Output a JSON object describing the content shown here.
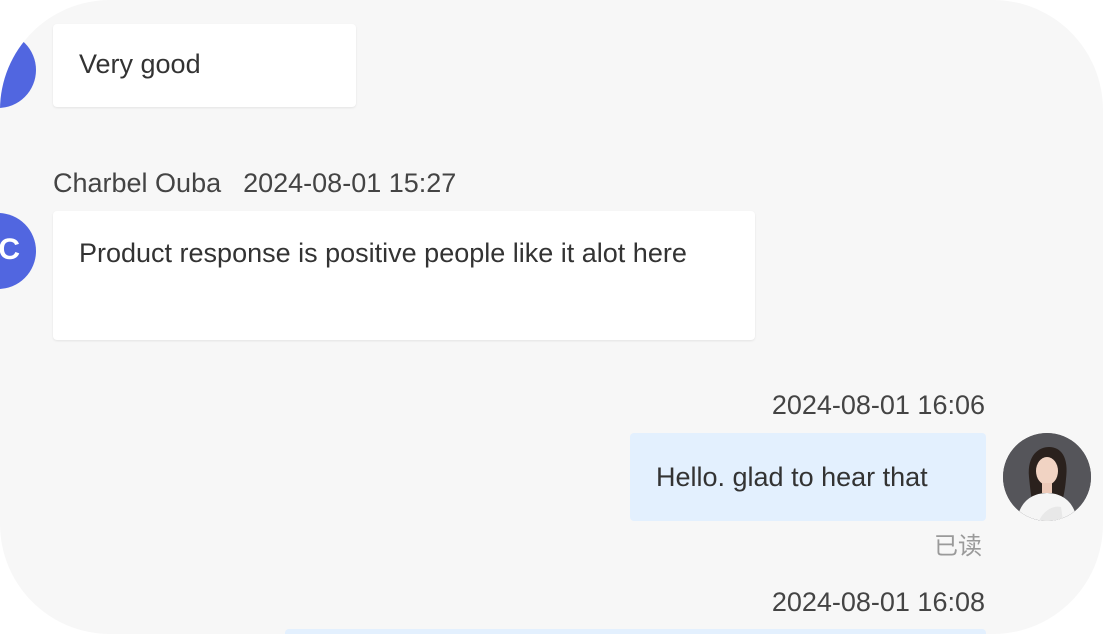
{
  "messages": [
    {
      "direction": "incoming",
      "text": "Very good"
    },
    {
      "direction": "incoming",
      "sender": "Charbel Ouba",
      "timestamp": "2024-08-01 15:27",
      "avatar_initial": "C",
      "text": "Product response is positive people like it alot here"
    },
    {
      "direction": "outgoing",
      "timestamp": "2024-08-01 16:06",
      "text": "Hello. glad to hear that",
      "read_status": "已读"
    },
    {
      "direction": "outgoing",
      "timestamp": "2024-08-01 16:08"
    }
  ],
  "colors": {
    "panel_bg": "#f7f7f7",
    "incoming_bubble": "#ffffff",
    "outgoing_bubble": "#e3f0fe",
    "avatar_accent": "#5166e0"
  },
  "icons": {
    "incoming_avatar": "user-initial-avatar",
    "outgoing_avatar": "user-photo-avatar"
  }
}
